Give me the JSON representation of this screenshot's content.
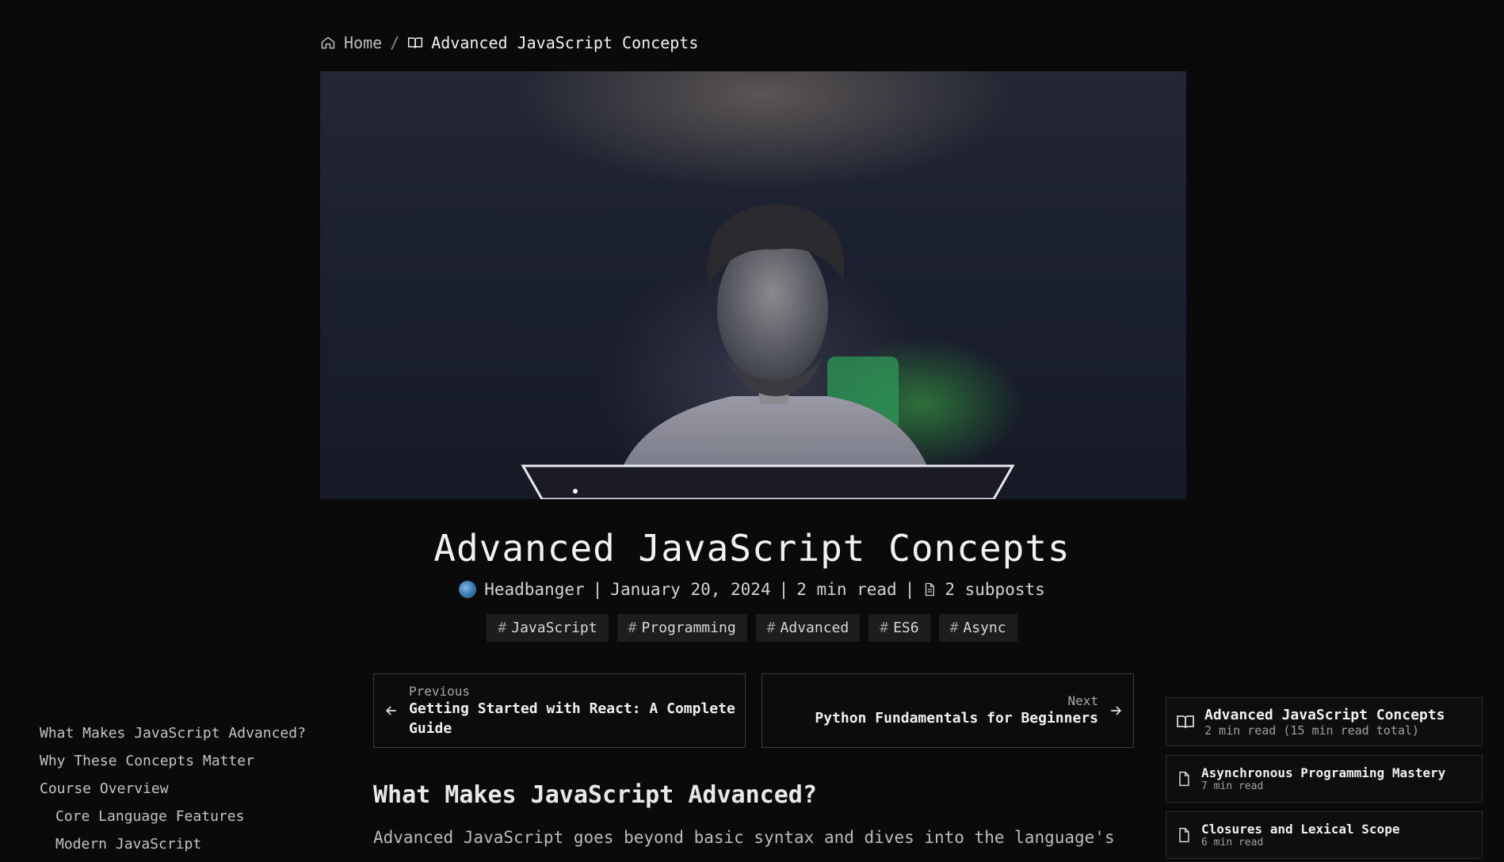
{
  "breadcrumb": {
    "home_label": "Home",
    "separator": "/",
    "current_label": "Advanced JavaScript Concepts",
    "home_icon": "home-icon",
    "current_icon": "book-open-icon"
  },
  "hero": {
    "image": "hero-image-person-at-laptop"
  },
  "post": {
    "title": "Advanced JavaScript Concepts",
    "author": "Headbanger",
    "date": "January 20, 2024",
    "read_time": "2 min read",
    "subposts": "2 subposts",
    "separator": "|",
    "tags": [
      {
        "hash": "#",
        "label": "JavaScript"
      },
      {
        "hash": "#",
        "label": "Programming"
      },
      {
        "hash": "#",
        "label": "Advanced"
      },
      {
        "hash": "#",
        "label": "ES6"
      },
      {
        "hash": "#",
        "label": "Async"
      }
    ]
  },
  "navigation": {
    "previous_label": "Previous",
    "previous_title_line1": "Getting Started with React: A Complete",
    "previous_title_line2": "Guide",
    "next_label": "Next",
    "next_title": "Python Fundamentals for Beginners"
  },
  "toc": {
    "items": [
      {
        "label": "What Makes JavaScript Advanced?"
      },
      {
        "label": "Why These Concepts Matter"
      },
      {
        "label": "Course Overview"
      },
      {
        "label": "Core Language Features"
      },
      {
        "label": "Modern JavaScript"
      }
    ]
  },
  "content": {
    "heading": "What Makes JavaScript Advanced?",
    "paragraph_start": "Advanced JavaScript goes beyond basic syntax and dives into the language's"
  },
  "series": {
    "items": [
      {
        "title": "Advanced JavaScript Concepts",
        "sub": "2 min read (15 min read total)",
        "icon": "book-open-icon"
      },
      {
        "title": "Asynchronous Programming Mastery",
        "sub": "7 min read",
        "icon": "file-icon"
      },
      {
        "title": "Closures and Lexical Scope",
        "sub": "6 min read",
        "icon": "file-icon"
      }
    ]
  },
  "colors": {
    "background": "#0a0a0a",
    "text": "#e6e6e6",
    "tag_background": "#1d1d1d",
    "card_border": "#3a3a3a"
  }
}
